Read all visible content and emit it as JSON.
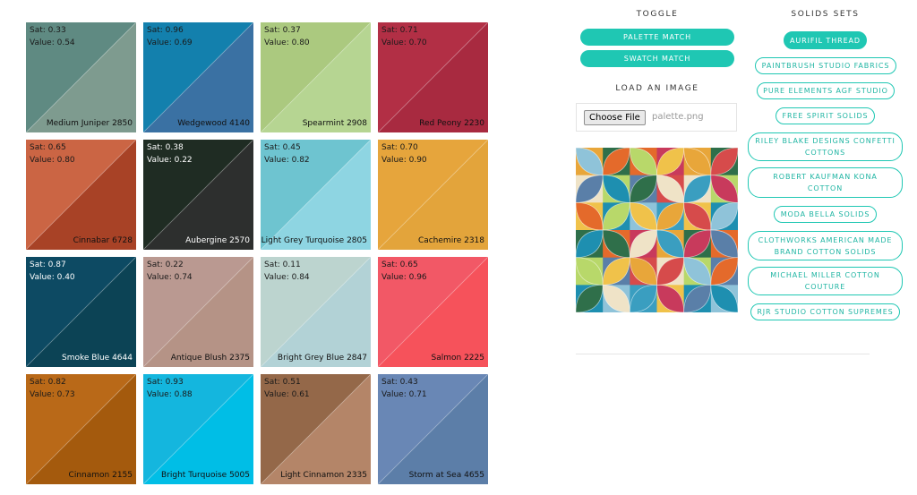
{
  "swatches": [
    {
      "name": "Medium Juniper 2850",
      "sat": "Sat: 0.33",
      "value": "Value: 0.54",
      "left_color": "#5f8a82",
      "right_color": "#7e9b8f",
      "dark": false
    },
    {
      "name": "Wedgewood 4140",
      "sat": "Sat: 0.96",
      "value": "Value: 0.69",
      "left_color": "#1380ad",
      "right_color": "#3a71a3",
      "dark": false
    },
    {
      "name": "Spearmint 2908",
      "sat": "Sat: 0.37",
      "value": "Value: 0.80",
      "left_color": "#abc97f",
      "right_color": "#b6d592",
      "dark": false
    },
    {
      "name": "Red Peony 2230",
      "sat": "Sat: 0.71",
      "value": "Value: 0.70",
      "left_color": "#b22f45",
      "right_color": "#a82a40",
      "dark": false
    },
    {
      "name": "Cinnabar 6728",
      "sat": "Sat: 0.65",
      "value": "Value: 0.80",
      "left_color": "#cb6544",
      "right_color": "#a84226",
      "dark": false
    },
    {
      "name": "Aubergine 2570",
      "sat": "Sat: 0.38",
      "value": "Value: 0.22",
      "left_color": "#1f2c23",
      "right_color": "#2d2f2e",
      "dark": true
    },
    {
      "name": "Light Grey Turquoise 2805",
      "sat": "Sat: 0.45",
      "value": "Value: 0.82",
      "left_color": "#6ec4d0",
      "right_color": "#8ed5e2",
      "dark": false
    },
    {
      "name": "Cachemire 2318",
      "sat": "Sat: 0.70",
      "value": "Value: 0.90",
      "left_color": "#e6a53c",
      "right_color": "#e3a43b",
      "dark": false
    },
    {
      "name": "Smoke Blue 4644",
      "sat": "Sat: 0.87",
      "value": "Value: 0.40",
      "left_color": "#0d4a63",
      "right_color": "#0c4355",
      "dark": true
    },
    {
      "name": "Antique Blush 2375",
      "sat": "Sat: 0.22",
      "value": "Value: 0.74",
      "left_color": "#ba9991",
      "right_color": "#b59386",
      "dark": false
    },
    {
      "name": "Bright Grey Blue 2847",
      "sat": "Sat: 0.11",
      "value": "Value: 0.84",
      "left_color": "#bcd4cf",
      "right_color": "#b2d2d6",
      "dark": false
    },
    {
      "name": "Salmon 2225",
      "sat": "Sat: 0.65",
      "value": "Value: 0.96",
      "left_color": "#f25866",
      "right_color": "#f6525b",
      "dark": false
    },
    {
      "name": "Cinnamon 2155",
      "sat": "Sat: 0.82",
      "value": "Value: 0.73",
      "left_color": "#b96918",
      "right_color": "#a45a0d",
      "dark": false
    },
    {
      "name": "Bright Turquoise 5005",
      "sat": "Sat: 0.93",
      "value": "Value: 0.88",
      "left_color": "#14b6de",
      "right_color": "#00bee6",
      "dark": false
    },
    {
      "name": "Light Cinnamon 2335",
      "sat": "Sat: 0.51",
      "value": "Value: 0.61",
      "left_color": "#946849",
      "right_color": "#b48568",
      "dark": false
    },
    {
      "name": "Storm at Sea 4655",
      "sat": "Sat: 0.43",
      "value": "Value: 0.71",
      "left_color": "#6987b5",
      "right_color": "#5c7ea8",
      "dark": false
    }
  ],
  "toggle": {
    "heading": "TOGGLE",
    "buttons": [
      "PALETTE MATCH",
      "SWATCH MATCH"
    ]
  },
  "load_image": {
    "heading": "LOAD AN IMAGE",
    "choose_label": "Choose File",
    "file_name": "palette.png"
  },
  "solids": {
    "heading": "SOLIDS SETS",
    "items": [
      {
        "label": "AURIFIL THREAD",
        "active": true
      },
      {
        "label": "PAINTBRUSH STUDIO FABRICS",
        "active": false
      },
      {
        "label": "PURE ELEMENTS AGF STUDIO",
        "active": false
      },
      {
        "label": "FREE SPIRIT SOLIDS",
        "active": false
      },
      {
        "label": "RILEY BLAKE DESIGNS CONFETTI COTTONS",
        "active": false
      },
      {
        "label": "ROBERT KAUFMAN KONA COTTON",
        "active": false
      },
      {
        "label": "MODA BELLA SOLIDS",
        "active": false
      },
      {
        "label": "CLOTHWORKS AMERICAN MADE BRAND COTTON SOLIDS",
        "active": false
      },
      {
        "label": "MICHAEL MILLER COTTON COUTURE",
        "active": false
      },
      {
        "label": "RJR STUDIO COTTON SUPREMES",
        "active": false
      }
    ]
  },
  "colors": {
    "accent": "#1fc7b3"
  }
}
